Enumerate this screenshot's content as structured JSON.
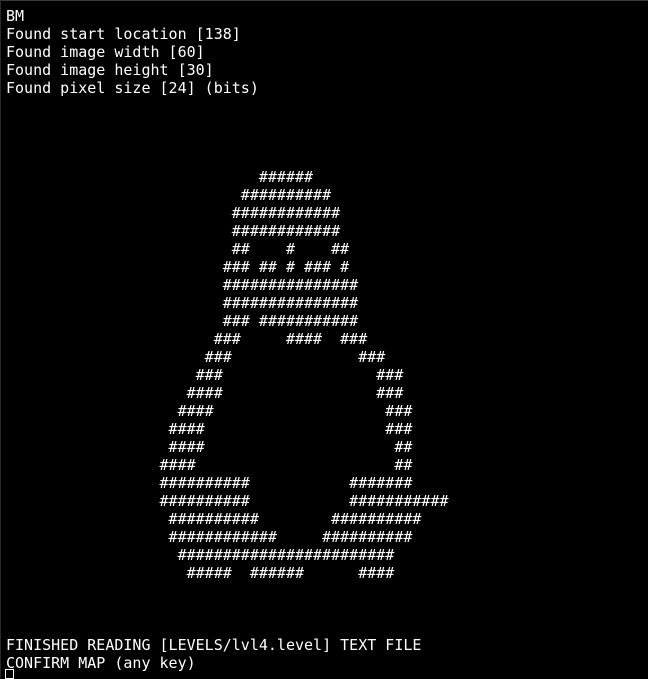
{
  "terminal": {
    "header_lines": [
      "BM",
      "Found start location [138]",
      "Found image width [60]",
      "Found image height [30]",
      "Found pixel size [24] (bits)"
    ],
    "map_rows": [
      "                            ######",
      "                          ##########",
      "                         ############",
      "                         ############",
      "                         ##    #    ##",
      "                        ### ## # ### #",
      "                        ###############",
      "                        ###############",
      "                        ### ###########",
      "                       ###     ####  ###",
      "                      ###              ###",
      "                     ###                 ###",
      "                    ####                 ###",
      "                   ####                   ###",
      "                  ####                    ###",
      "                  ####                     ##",
      "                 ####                      ##",
      "                 ##########           #######",
      "                 ##########           ###########",
      "                  ##########        ##########",
      "                  ############     ##########",
      "                   ########################",
      "                    #####  ######      ####"
    ],
    "footer_lines": [
      "FINISHED READING [LEVELS/lvl4.level] TEXT FILE",
      "CONFIRM MAP (any key)"
    ],
    "colors": {
      "background": "#000000",
      "text": "#ffffff"
    }
  }
}
